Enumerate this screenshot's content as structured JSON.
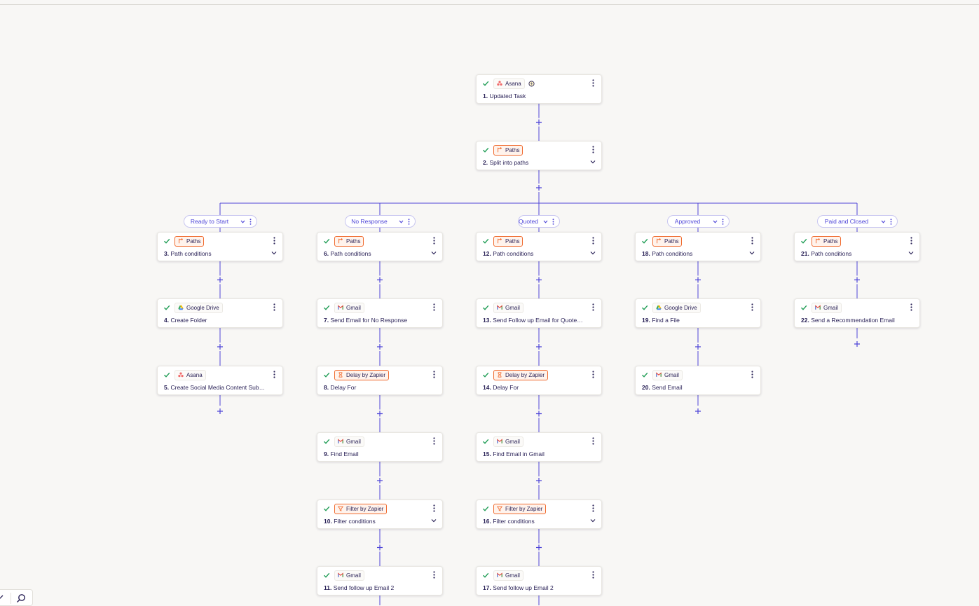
{
  "canvas": {
    "trigger": {
      "app": "Asana",
      "title": "Updated Task",
      "num": "1."
    },
    "splitter": {
      "app": "Paths",
      "title": "Split into paths",
      "num": "2."
    },
    "paths": [
      {
        "label": "Ready to Start",
        "steps": [
          {
            "num": "3.",
            "app": "Paths",
            "title": "Path conditions"
          },
          {
            "num": "4.",
            "app": "Google Drive",
            "title": "Create Folder"
          },
          {
            "num": "5.",
            "app": "Asana",
            "title": "Create Social Media Content Subtask"
          }
        ]
      },
      {
        "label": "No Response",
        "steps": [
          {
            "num": "6.",
            "app": "Paths",
            "title": "Path conditions"
          },
          {
            "num": "7.",
            "app": "Gmail",
            "title": "Send Email for No Response"
          },
          {
            "num": "8.",
            "app": "Delay by Zapier",
            "title": "Delay For"
          },
          {
            "num": "9.",
            "app": "Gmail",
            "title": "Find Email"
          },
          {
            "num": "10.",
            "app": "Filter by Zapier",
            "title": "Filter conditions"
          },
          {
            "num": "11.",
            "app": "Gmail",
            "title": "Send follow up Email 2"
          }
        ]
      },
      {
        "label": "Quoted",
        "steps": [
          {
            "num": "12.",
            "app": "Paths",
            "title": "Path conditions"
          },
          {
            "num": "13.",
            "app": "Gmail",
            "title": "Send Follow up Email for Quoted..."
          },
          {
            "num": "14.",
            "app": "Delay by Zapier",
            "title": "Delay For"
          },
          {
            "num": "15.",
            "app": "Gmail",
            "title": "Find Email in Gmail"
          },
          {
            "num": "16.",
            "app": "Filter by Zapier",
            "title": "Filter conditions"
          },
          {
            "num": "17.",
            "app": "Gmail",
            "title": "Send follow up Email 2"
          }
        ]
      },
      {
        "label": "Approved",
        "steps": [
          {
            "num": "18.",
            "app": "Paths",
            "title": "Path conditions"
          },
          {
            "num": "19.",
            "app": "Google Drive",
            "title": "Find a File"
          },
          {
            "num": "20.",
            "app": "Gmail",
            "title": "Send Email"
          }
        ]
      },
      {
        "label": "Paid and Closed",
        "steps": [
          {
            "num": "21.",
            "app": "Paths",
            "title": "Path conditions"
          },
          {
            "num": "22.",
            "app": "Gmail",
            "title": "Send a Recommendation Email"
          }
        ]
      }
    ]
  },
  "colors": {
    "accent": "#4f46d8",
    "success": "#1f9d55",
    "orange": "#f06b2f",
    "text": "#2b2358"
  },
  "icons": {
    "Asana": "asana-icon",
    "Paths": "paths-icon",
    "Gmail": "gmail-icon",
    "Google Drive": "google-drive-icon",
    "Delay by Zapier": "delay-icon",
    "Filter by Zapier": "filter-icon"
  }
}
